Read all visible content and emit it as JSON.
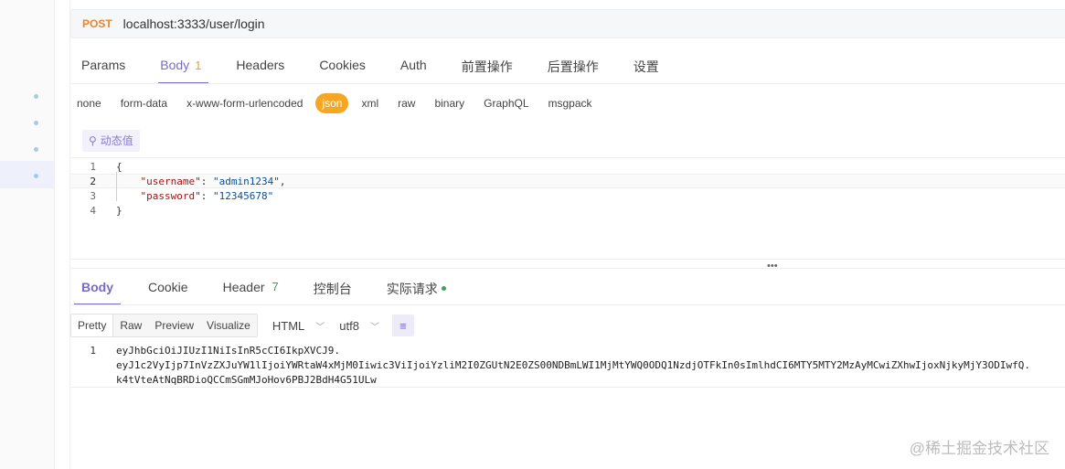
{
  "request": {
    "method": "POST",
    "url": "localhost:3333/user/login"
  },
  "request_tabs": [
    {
      "label": "Params"
    },
    {
      "label": "Body",
      "badge": "1"
    },
    {
      "label": "Headers"
    },
    {
      "label": "Cookies"
    },
    {
      "label": "Auth"
    },
    {
      "label": "前置操作"
    },
    {
      "label": "后置操作"
    },
    {
      "label": "设置"
    }
  ],
  "body_types": [
    "none",
    "form-data",
    "x-www-form-urlencoded",
    "json",
    "xml",
    "raw",
    "binary",
    "GraphQL",
    "msgpack"
  ],
  "selected_body_type": "json",
  "dynamic_value_button": "动态值",
  "editor": {
    "line_numbers": [
      "1",
      "2",
      "3",
      "4"
    ],
    "open_brace": "{",
    "close_brace": "}",
    "username_key": "\"username\"",
    "username_value": "\"admin1234\"",
    "password_key": "\"password\"",
    "password_value": "\"12345678\""
  },
  "response_tabs": [
    {
      "label": "Body"
    },
    {
      "label": "Cookie"
    },
    {
      "label": "Header",
      "badge": "7"
    },
    {
      "label": "控制台"
    },
    {
      "label": "实际请求"
    }
  ],
  "format_modes": [
    "Pretty",
    "Raw",
    "Preview",
    "Visualize"
  ],
  "format_select": "HTML",
  "encoding_select": "utf8",
  "response_body": {
    "line_number": "1",
    "lines": [
      "eyJhbGciOiJIUzI1NiIsInR5cCI6IkpXVCJ9.",
      "eyJ1c2VyIjp7InVzZXJuYW1lIjoiYWRtaW4xMjM0Iiwic3ViIjoiYzliM2I0ZGUtN2E0ZS00NDBmLWI1MjMtYWQ0ODQ1NzdjOTFkIn0sImlhdCI6MTY5MTY2MzAyMCwiZXhwIjoxNjkyMjY3ODIwfQ.",
      "k4tVteAtNqBRDioQCCmSGmMJoHov6PBJ2BdH4G51ULw"
    ]
  },
  "watermark": "@稀土掘金技术社区",
  "colors": {
    "accent": "#7a69c8",
    "method": "#e9852d",
    "json_pill": "#f5a623",
    "status_green": "#3aa54a"
  }
}
